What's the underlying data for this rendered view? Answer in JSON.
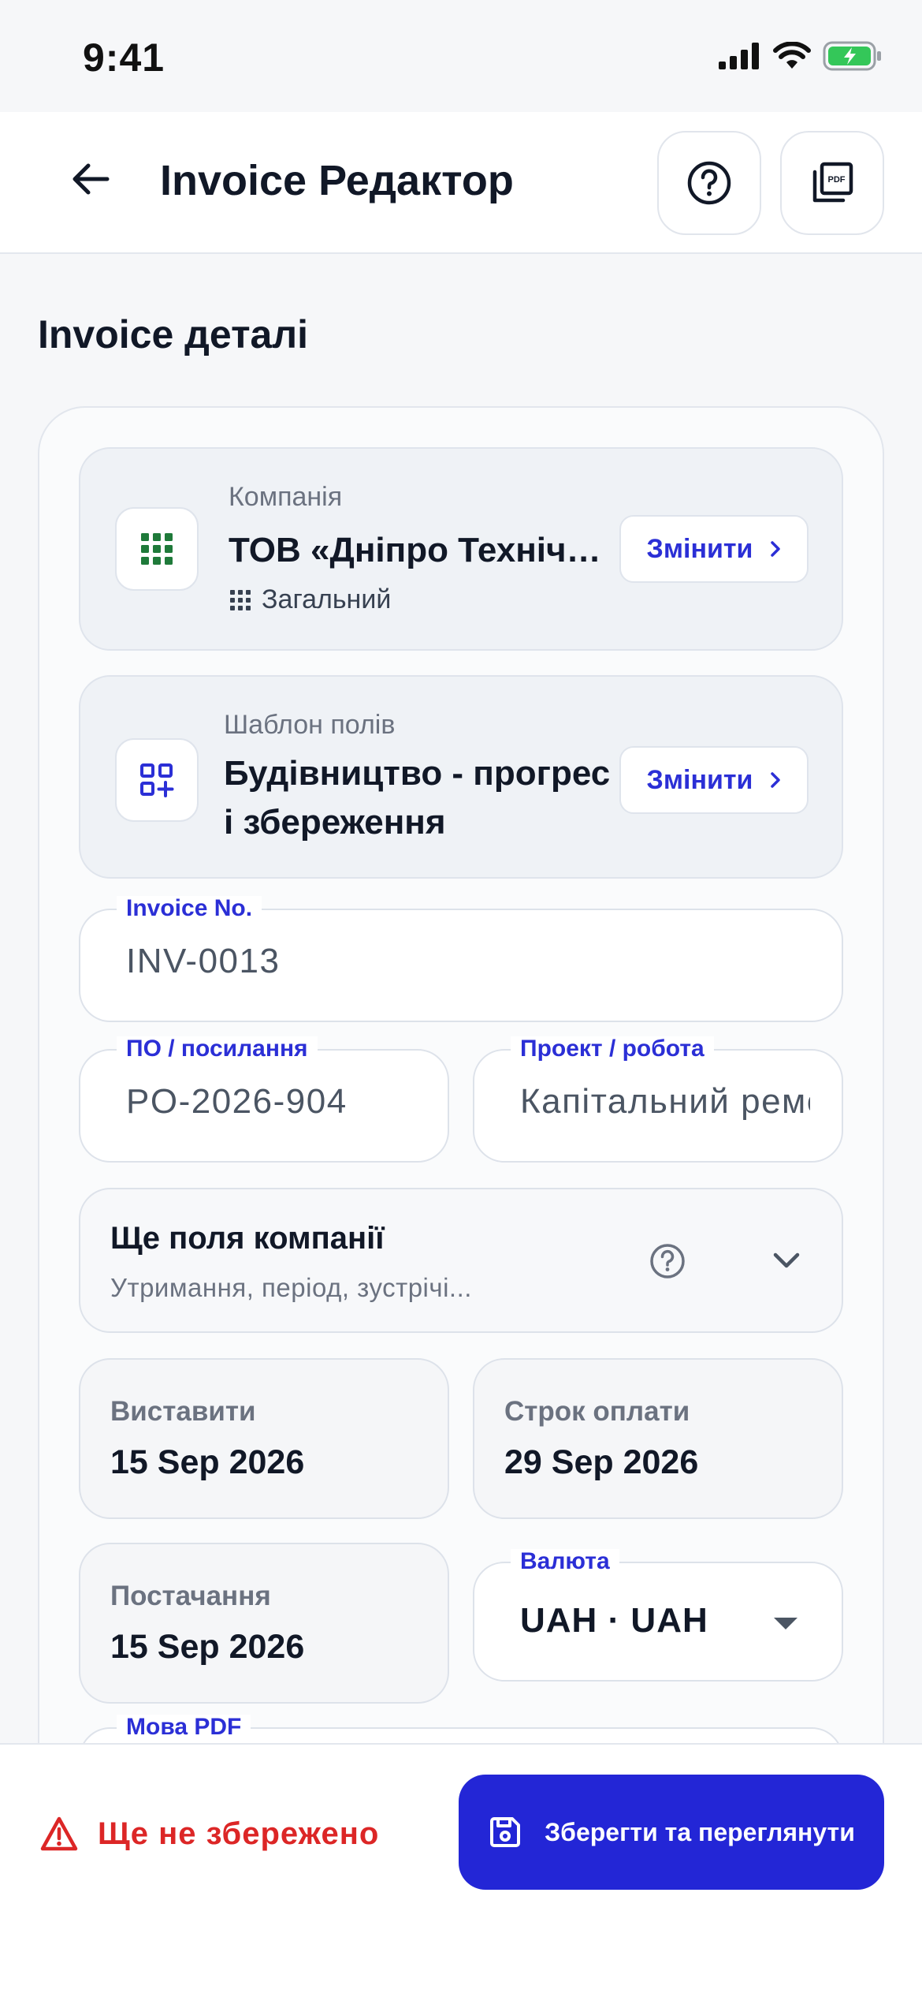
{
  "status_bar": {
    "time": "9:41"
  },
  "header": {
    "title": "Invoice Редактор",
    "icons": {
      "back": "arrow-left-icon",
      "help": "help-circle-icon",
      "pdf": "pdf-file-icon"
    }
  },
  "section": {
    "title": "Invoice деталі"
  },
  "company": {
    "label": "Компанія",
    "name": "ТОВ «Дніпро Технічний Сервіс»",
    "category": "Загальний",
    "change_label": "Змінити"
  },
  "template": {
    "label": "Шаблон полів",
    "name": "Будівництво - прогрес і збереження",
    "change_label": "Змінити"
  },
  "fields": {
    "invoice_no": {
      "label": "Invoice No.",
      "value": "INV-0013"
    },
    "po_ref": {
      "label": "ПО / посилання",
      "value": "PO-2026-904"
    },
    "project": {
      "label": "Проект / робота",
      "value": "Капітальний ремонт"
    },
    "currency": {
      "label": "Валюта",
      "value": "UAH · UAH"
    },
    "pdf_language": {
      "label": "Мова PDF"
    }
  },
  "more_fields": {
    "title": "Ще поля компанії",
    "subtitle": "Утримання, період, зустрічі..."
  },
  "dates": {
    "issue": {
      "label": "Виставити",
      "value": "15 Sep 2026"
    },
    "due": {
      "label": "Строк оплати",
      "value": "29 Sep 2026"
    },
    "supply": {
      "label": "Постачання",
      "value": "15 Sep 2026"
    }
  },
  "footer": {
    "unsaved_text": "Ще не збережено",
    "save_label": "Зберегти та переглянути"
  },
  "colors": {
    "accent": "#2326d6",
    "accent_text": "#2b2fd6",
    "warning": "#dc2626",
    "company_icon": "#1f7a3a",
    "battery": "#34c759"
  }
}
